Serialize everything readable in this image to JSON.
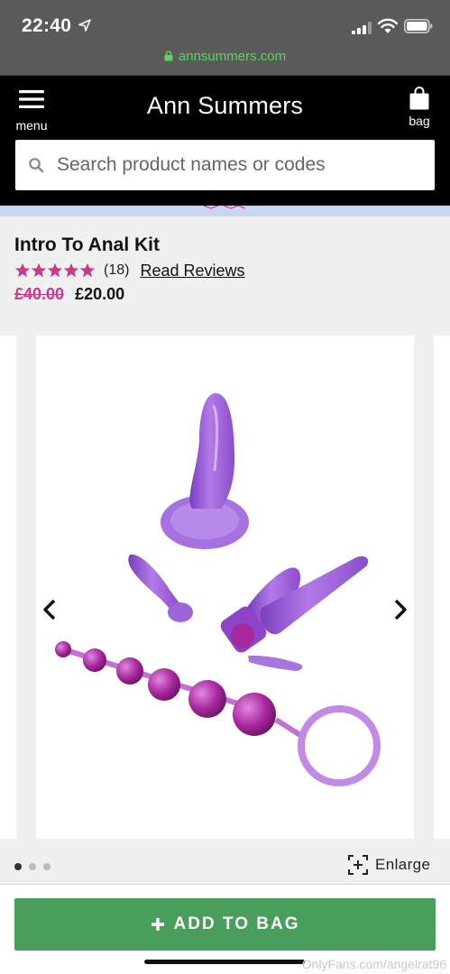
{
  "status_bar": {
    "time": "22:40"
  },
  "url_bar": {
    "domain": "annsummers.com"
  },
  "header": {
    "menu_label": "menu",
    "logo_text": "Ann Summers",
    "bag_label": "bag",
    "search": {
      "placeholder": "Search product names or codes",
      "value": ""
    }
  },
  "product": {
    "title": "Intro To Anal Kit",
    "rating_stars": 5,
    "review_count": "(18)",
    "read_reviews_label": "Read Reviews",
    "old_price": "£40.00",
    "new_price": "£20.00"
  },
  "carousel": {
    "slide_count": 3,
    "active_index": 0,
    "enlarge_label": "Enlarge"
  },
  "cta": {
    "add_to_bag_label": "ADD TO BAG"
  },
  "watermark": "OnlyFans.com/angelrat96",
  "colors": {
    "brand_black": "#000000",
    "price_pink": "#c93a8a",
    "cta_green": "#4a9e5c",
    "url_green": "#5fd35f",
    "product_purple": "#9b59d0"
  },
  "icons": [
    "location-arrow-icon",
    "signal-icon",
    "wifi-icon",
    "battery-icon",
    "lock-icon",
    "hamburger-icon",
    "bag-icon",
    "search-icon",
    "star-icon",
    "chevron-left-icon",
    "chevron-right-icon",
    "enlarge-icon",
    "plus-icon"
  ]
}
